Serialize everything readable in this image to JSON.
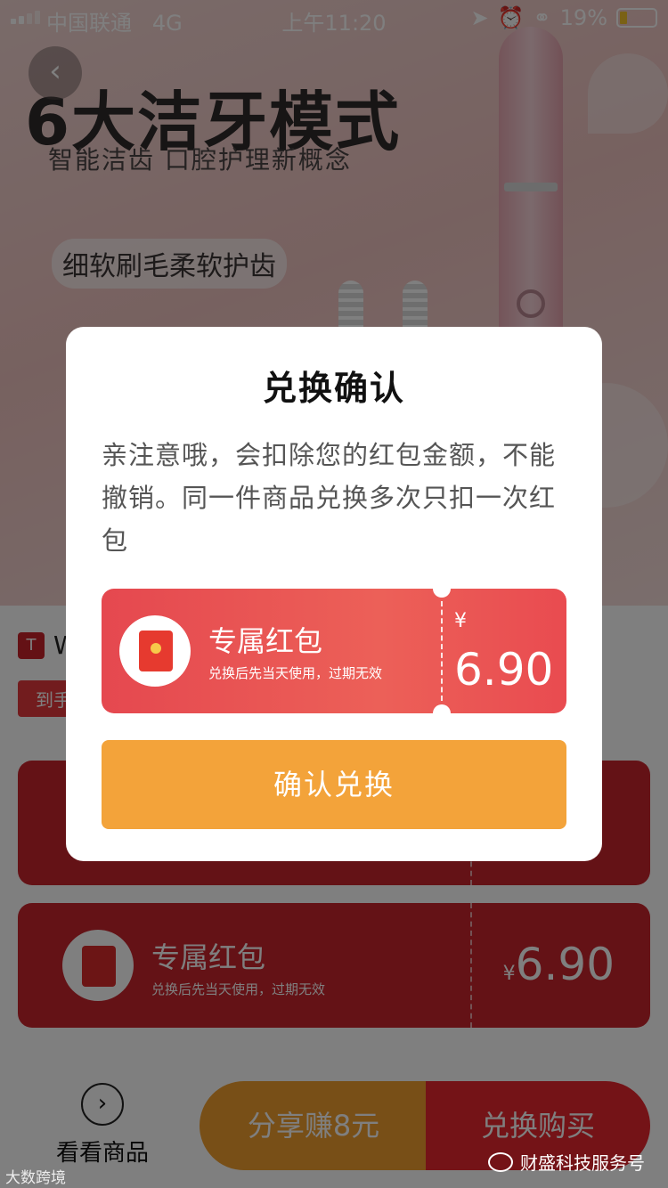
{
  "status_bar": {
    "carrier": "中国联通",
    "network": "4G",
    "time": "上午11:20",
    "battery": "19%"
  },
  "banner": {
    "title": "6大洁牙模式",
    "subtitle": "智能洁齿 口腔护理新概念",
    "chip": "细软刷毛柔软护齿",
    "back_icon": "chevron-left-icon"
  },
  "page": {
    "shop_name": "W",
    "tag_label": "到手",
    "coupon": {
      "title": "专属红包",
      "desc": "兑换后先当天使用，过期无效",
      "currency": "¥",
      "amount": "6.90"
    }
  },
  "bottom_bar": {
    "goods_label": "看看商品",
    "share_label": "分享赚8元",
    "buy_label": "兑换购买"
  },
  "modal": {
    "title": "兑换确认",
    "message": "亲注意哦，会扣除您的红包金额，不能撤销。同一件商品兑换多次只扣一次红包",
    "coupon": {
      "title": "专属红包",
      "desc": "兑换后先当天使用，过期无效",
      "currency": "¥",
      "amount": "6.90"
    },
    "confirm_label": "确认兑换"
  },
  "watermarks": {
    "left": "大数跨境",
    "right": "财盛科技服务号"
  },
  "colors": {
    "coupon_red": "#e5484f",
    "confirm_orange": "#f3a33a",
    "buy_red": "#e8262f"
  }
}
